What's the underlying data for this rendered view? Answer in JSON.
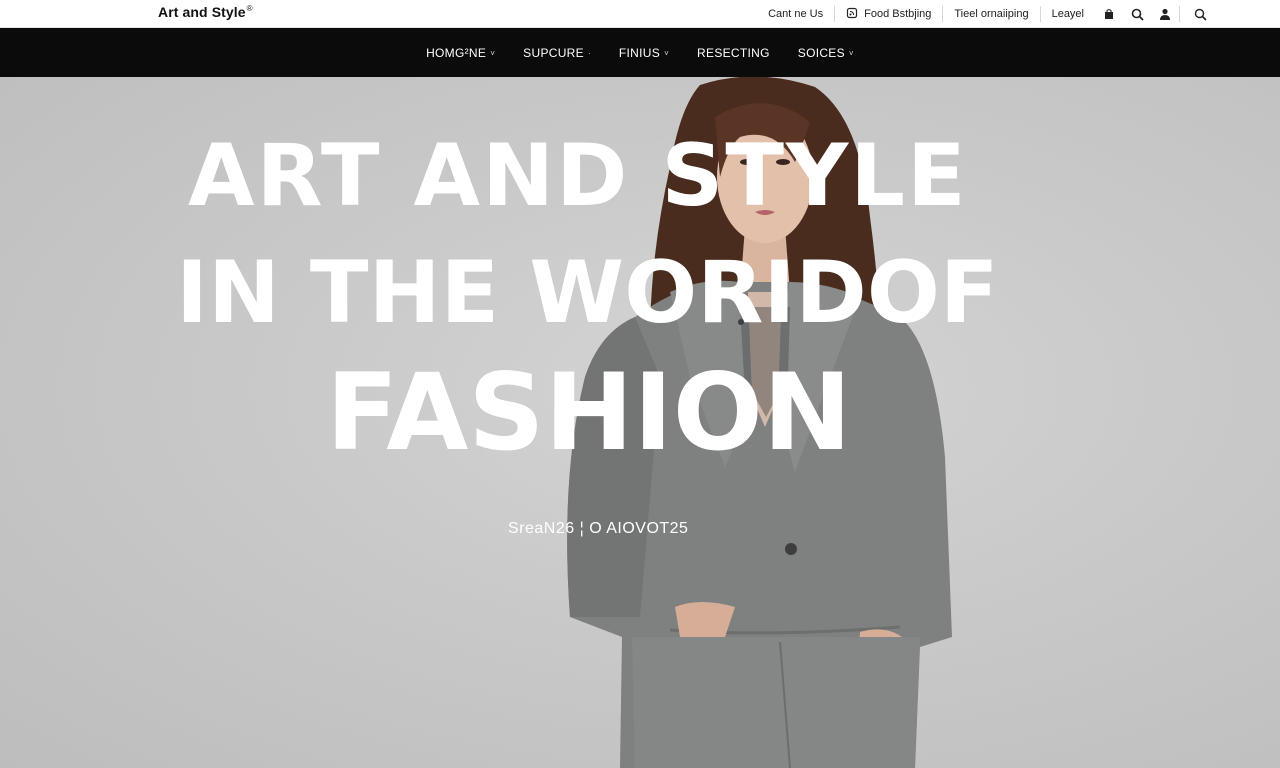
{
  "brand": {
    "logo_text": "Art and Style",
    "logo_mark": "®"
  },
  "utility": {
    "contact_label": "Cant ne Us",
    "food_label": "Food Bstbjing",
    "tool_label": "Tieel ornaiiping",
    "legal_label": "Leayel"
  },
  "nav": {
    "items": [
      {
        "label": "HOMG²NE",
        "chevron": "˅"
      },
      {
        "label": "SUPCURE",
        "chevron": "·"
      },
      {
        "label": "FINIUS",
        "chevron": "˅"
      },
      {
        "label": "RESECTING",
        "chevron": ""
      },
      {
        "label": "SOICES",
        "chevron": "˅"
      }
    ]
  },
  "hero": {
    "line1": "ART AND STYLE",
    "line2": "IN THE WORIDOF",
    "line3": "FASHION",
    "subtitle": "SreaN26 ¦  O AIOVOT25"
  },
  "colors": {
    "nav_background": "#0b0b0b",
    "hero_background": "#c9c9c9",
    "coat": "#7f8080",
    "hair": "#4a2c1f"
  },
  "icons": [
    "feed-icon",
    "bag-icon",
    "search-icon",
    "user-icon",
    "search-icon"
  ]
}
